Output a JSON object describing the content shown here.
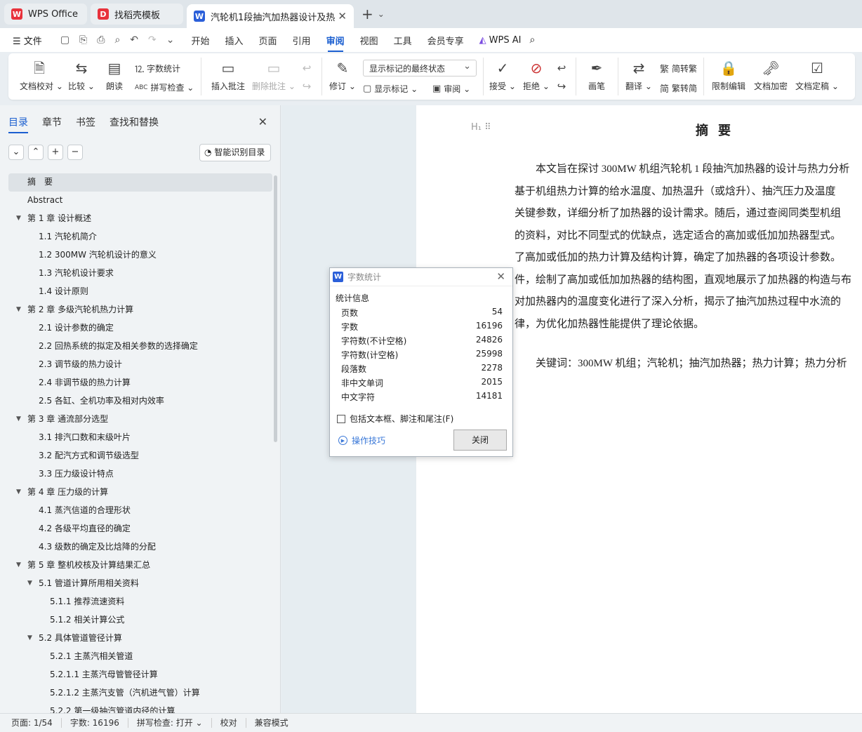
{
  "tabs": [
    {
      "label": "WPS Office",
      "logo": "W",
      "color": "#e8323c"
    },
    {
      "label": "找稻壳模板",
      "logo": "D",
      "color": "#e8323c"
    },
    {
      "label": "汽轮机1段抽汽加热器设计及热",
      "logo": "W",
      "color": "#2b5fd9"
    }
  ],
  "menubar": {
    "file": "文件",
    "items": [
      "开始",
      "插入",
      "页面",
      "引用",
      "审阅",
      "视图",
      "工具",
      "会员专享"
    ],
    "active": "审阅",
    "wps_ai": "WPS AI"
  },
  "ribbon": {
    "doc_check": "文档校对",
    "compare": "比较",
    "read_aloud": "朗读",
    "word_count": "字数统计",
    "spell_check": "拼写检查",
    "insert_comment": "插入批注",
    "delete_comment": "删除批注",
    "revise": "修订",
    "markup_state": "显示标记的最终状态",
    "show_markup": "显示标记",
    "review": "审阅",
    "accept": "接受",
    "reject": "拒绝",
    "pen": "画笔",
    "translate": "翻译",
    "to_traditional": "简转繁",
    "to_simplified": "繁转简",
    "restrict_edit": "限制编辑",
    "encrypt": "文档加密",
    "finalize": "文档定稿"
  },
  "sidebar": {
    "tabs": [
      "目录",
      "章节",
      "书签",
      "查找和替换"
    ],
    "active_tab": "目录",
    "smart_toc": "智能识别目录",
    "toc": [
      {
        "label": "摘　要",
        "level": 1,
        "arrow": false,
        "selected": true
      },
      {
        "label": "Abstract",
        "level": 1,
        "arrow": false
      },
      {
        "label": "第 1 章  设计概述",
        "level": 1,
        "arrow": true
      },
      {
        "label": "1.1 汽轮机简介",
        "level": 2,
        "arrow": false
      },
      {
        "label": "1.2 300MW 汽轮机设计的意义",
        "level": 2,
        "arrow": false
      },
      {
        "label": "1.3 汽轮机设计要求",
        "level": 2,
        "arrow": false
      },
      {
        "label": "1.4 设计原则",
        "level": 2,
        "arrow": false
      },
      {
        "label": "第 2 章  多级汽轮机热力计算",
        "level": 1,
        "arrow": true
      },
      {
        "label": "2.1 设计参数的确定",
        "level": 2,
        "arrow": false
      },
      {
        "label": "2.2 回热系统的拟定及相关参数的选择确定",
        "level": 2,
        "arrow": false
      },
      {
        "label": "2.3 调节级的热力设计",
        "level": 2,
        "arrow": false
      },
      {
        "label": "2.4 非调节级的热力计算",
        "level": 2,
        "arrow": false
      },
      {
        "label": "2.5 各缸、全机功率及相对内效率",
        "level": 2,
        "arrow": false
      },
      {
        "label": "第 3 章  通流部分选型",
        "level": 1,
        "arrow": true
      },
      {
        "label": "3.1 排汽口数和末级叶片",
        "level": 2,
        "arrow": false
      },
      {
        "label": "3.2 配汽方式和调节级选型",
        "level": 2,
        "arrow": false
      },
      {
        "label": "3.3 压力级设计特点",
        "level": 2,
        "arrow": false
      },
      {
        "label": "第 4 章  压力级的计算",
        "level": 1,
        "arrow": true
      },
      {
        "label": "4.1 蒸汽信道的合理形状",
        "level": 2,
        "arrow": false
      },
      {
        "label": "4.2 各级平均直径的确定",
        "level": 2,
        "arrow": false
      },
      {
        "label": "4.3 级数的确定及比焓降的分配",
        "level": 2,
        "arrow": false
      },
      {
        "label": "第 5 章  整机校核及计算结果汇总",
        "level": 1,
        "arrow": true
      },
      {
        "label": "5.1 管道计算所用相关资料",
        "level": 2,
        "arrow": true
      },
      {
        "label": "5.1.1 推荐流速资料",
        "level": 3,
        "arrow": false
      },
      {
        "label": "5.1.2  相关计算公式",
        "level": 3,
        "arrow": false
      },
      {
        "label": "5.2 具体管道管径计算",
        "level": 2,
        "arrow": true
      },
      {
        "label": "5.2.1 主蒸汽相关管道",
        "level": 3,
        "arrow": false
      },
      {
        "label": "5.2.1.1    主蒸汽母管管径计算",
        "level": 3,
        "arrow": false
      },
      {
        "label": "5.2.1.2    主蒸汽支管（汽机进气管）计算",
        "level": 3,
        "arrow": false
      },
      {
        "label": "5.2.2    第一级抽汽管道内径的计算",
        "level": 3,
        "arrow": false
      }
    ]
  },
  "document": {
    "title": "摘要",
    "lines": [
      "　　本文旨在探讨 300MW 机组汽轮机 1 段抽汽加热器的设计与热力分析",
      "基于机组热力计算的给水温度、加热温升（或焓升）、抽汽压力及温度",
      "关键参数，详细分析了加热器的设计需求。随后，通过查阅同类型机组",
      "的资料，对比不同型式的优缺点，选定适合的高加或低加加热器型式。",
      "了高加或低加的热力计算及结构计算，确定了加热器的各项设计参数。",
      "件，绘制了高加或低加加热器的结构图，直观地展示了加热器的构造与布",
      "对加热器内的温度变化进行了深入分析，揭示了抽汽加热过程中水流的",
      "律，为优化加热器性能提供了理论依据。"
    ],
    "keywords": "关键词：300MW 机组；汽轮机；抽汽加热器；热力计算；热力分析"
  },
  "dialog": {
    "title": "字数统计",
    "section": "统计信息",
    "stats": [
      {
        "label": "页数",
        "value": "54"
      },
      {
        "label": "字数",
        "value": "16196"
      },
      {
        "label": "字符数(不计空格)",
        "value": "24826"
      },
      {
        "label": "字符数(计空格)",
        "value": "25998"
      },
      {
        "label": "段落数",
        "value": "2278"
      },
      {
        "label": "非中文单词",
        "value": "2015"
      },
      {
        "label": "中文字符",
        "value": "14181"
      }
    ],
    "checkbox": "包括文本框、脚注和尾注(F)",
    "tips": "操作技巧",
    "close": "关闭"
  },
  "statusbar": {
    "page": "页面: 1/54",
    "words": "字数: 16196",
    "spell": "拼写检查: 打开 ⌄",
    "proof": "校对",
    "compat": "兼容模式"
  }
}
